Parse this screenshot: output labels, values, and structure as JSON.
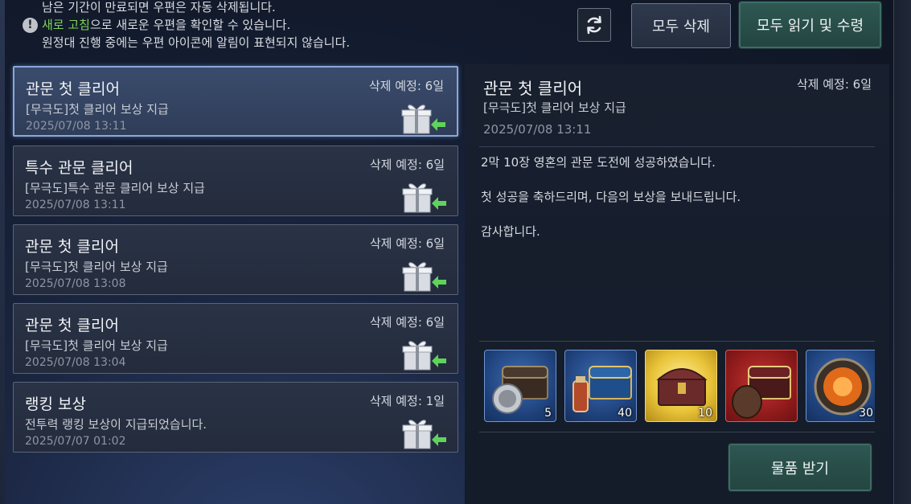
{
  "notice": {
    "line1": "남은 기간이 만료되면 우편은 자동 삭제됩니다.",
    "line2_highlight": "새로 고침",
    "line2_rest": "으로 새로운 우편을 확인할 수 있습니다.",
    "line3": "원정대 진행 중에는 우편 아이콘에 알림이 표현되지 않습니다.",
    "icon": "!"
  },
  "toolbar": {
    "delete_all": "모두 삭제",
    "read_all": "모두 읽기 및 수령"
  },
  "mails": [
    {
      "title": "관문 첫 클리어",
      "sub": "[무극도]첫 클리어 보상 지급",
      "date": "2025/07/08 13:11",
      "expiry": "삭제 예정: 6일"
    },
    {
      "title": "특수 관문 클리어",
      "sub": "[무극도]특수 관문 클리어 보상 지급",
      "date": "2025/07/08 13:11",
      "expiry": "삭제 예정: 6일"
    },
    {
      "title": "관문 첫 클리어",
      "sub": "[무극도]첫 클리어 보상 지급",
      "date": "2025/07/08 13:08",
      "expiry": "삭제 예정: 6일"
    },
    {
      "title": "관문 첫 클리어",
      "sub": "[무극도]첫 클리어 보상 지급",
      "date": "2025/07/08 13:04",
      "expiry": "삭제 예정: 6일"
    },
    {
      "title": "랭킹 보상",
      "sub": "전투력 랭킹 보상이 지급되었습니다.",
      "date": "2025/07/07 01:02",
      "expiry": "삭제 예정: 1일"
    }
  ],
  "detail": {
    "title": "관문 첫 클리어",
    "sub": "[무극도]첫 클리어 보상 지급",
    "date": "2025/07/08 13:11",
    "expiry": "삭제 예정: 6일",
    "body": [
      "2막 10장 영혼의 관문 도전에 성공하였습니다.",
      "첫 성공을 축하드리며, 다음의 보상을 보내드립니다.",
      "감사합니다."
    ],
    "rewards": [
      {
        "count": "5",
        "rarity": "blue"
      },
      {
        "count": "40",
        "rarity": "blue"
      },
      {
        "count": "10",
        "rarity": "yellow"
      },
      {
        "count": "",
        "rarity": "red"
      },
      {
        "count": "30",
        "rarity": "blue"
      }
    ],
    "receive_label": "물품 받기"
  },
  "colors": {
    "accent_green": "#7ed35a",
    "selected_border": "#8aa8d8",
    "gift_arrow": "#5fd35a"
  }
}
